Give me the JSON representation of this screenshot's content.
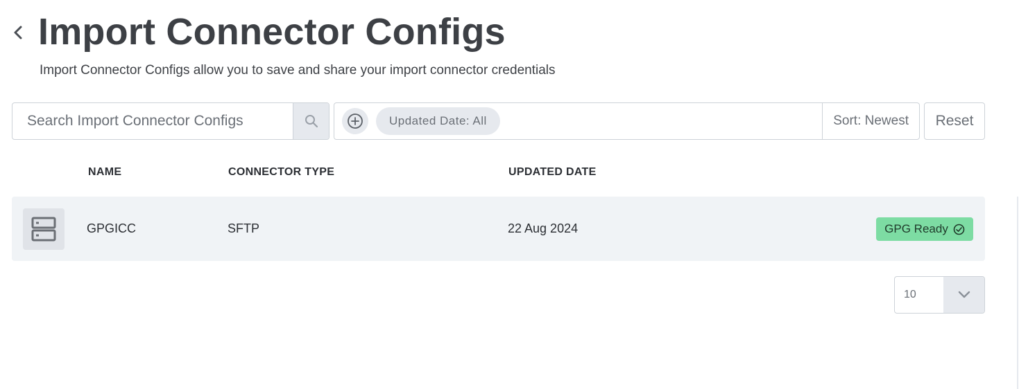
{
  "header": {
    "title": "Import Connector Configs",
    "subtitle": "Import Connector Configs allow you to save and share your import connector credentials",
    "back_icon": "chevron-left-icon"
  },
  "toolbar": {
    "search_placeholder": "Search Import Connector Configs",
    "search_value": "",
    "search_icon": "search-icon",
    "add_filter_icon": "plus-circle-icon",
    "filter_chip_label": "Updated Date: All",
    "sort_label": "Sort: Newest",
    "reset_label": "Reset"
  },
  "table": {
    "columns": [
      "NAME",
      "CONNECTOR TYPE",
      "UPDATED DATE"
    ],
    "rows": [
      {
        "icon": "server-icon",
        "name": "GPGICC",
        "connector_type": "SFTP",
        "updated_date": "22 Aug 2024",
        "status": "GPG Ready",
        "status_icon": "check-circle-icon"
      }
    ]
  },
  "pagination": {
    "page_size": "10",
    "toggle_icon": "chevron-down-icon"
  },
  "colors": {
    "title": "#3d4045",
    "border": "#cdd2d8",
    "control_bg": "#e6e9ee",
    "row_bg": "#f0f3f6",
    "status_badge": "#7ddca3"
  }
}
